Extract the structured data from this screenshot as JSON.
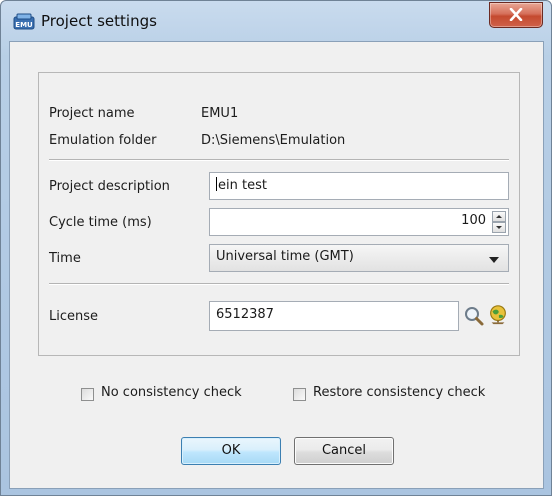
{
  "window": {
    "title": "Project settings",
    "app_icon": "emu-app-icon",
    "close_icon": "close-icon"
  },
  "info": {
    "project_name_label": "Project name",
    "project_name_value": "EMU1",
    "emulation_folder_label": "Emulation folder",
    "emulation_folder_value": "D:\\Siemens\\Emulation"
  },
  "form": {
    "description_label": "Project description",
    "description_value": "ein test",
    "cycle_time_label": "Cycle time (ms)",
    "cycle_time_value": "100",
    "time_label": "Time",
    "time_selected": "Universal time (GMT)",
    "license_label": "License",
    "license_value": "6512387",
    "license_icons": [
      "search-icon",
      "globe-icon"
    ]
  },
  "options": {
    "no_consistency_check": "No consistency check",
    "no_consistency_check_checked": false,
    "restore_consistency_check": "Restore consistency check",
    "restore_consistency_check_checked": false
  },
  "buttons": {
    "ok": "OK",
    "cancel": "Cancel"
  },
  "colors": {
    "title_bar": "#b8cfe6",
    "close_button": "#c44a2f",
    "ok_button_border": "#3c7fb1"
  }
}
